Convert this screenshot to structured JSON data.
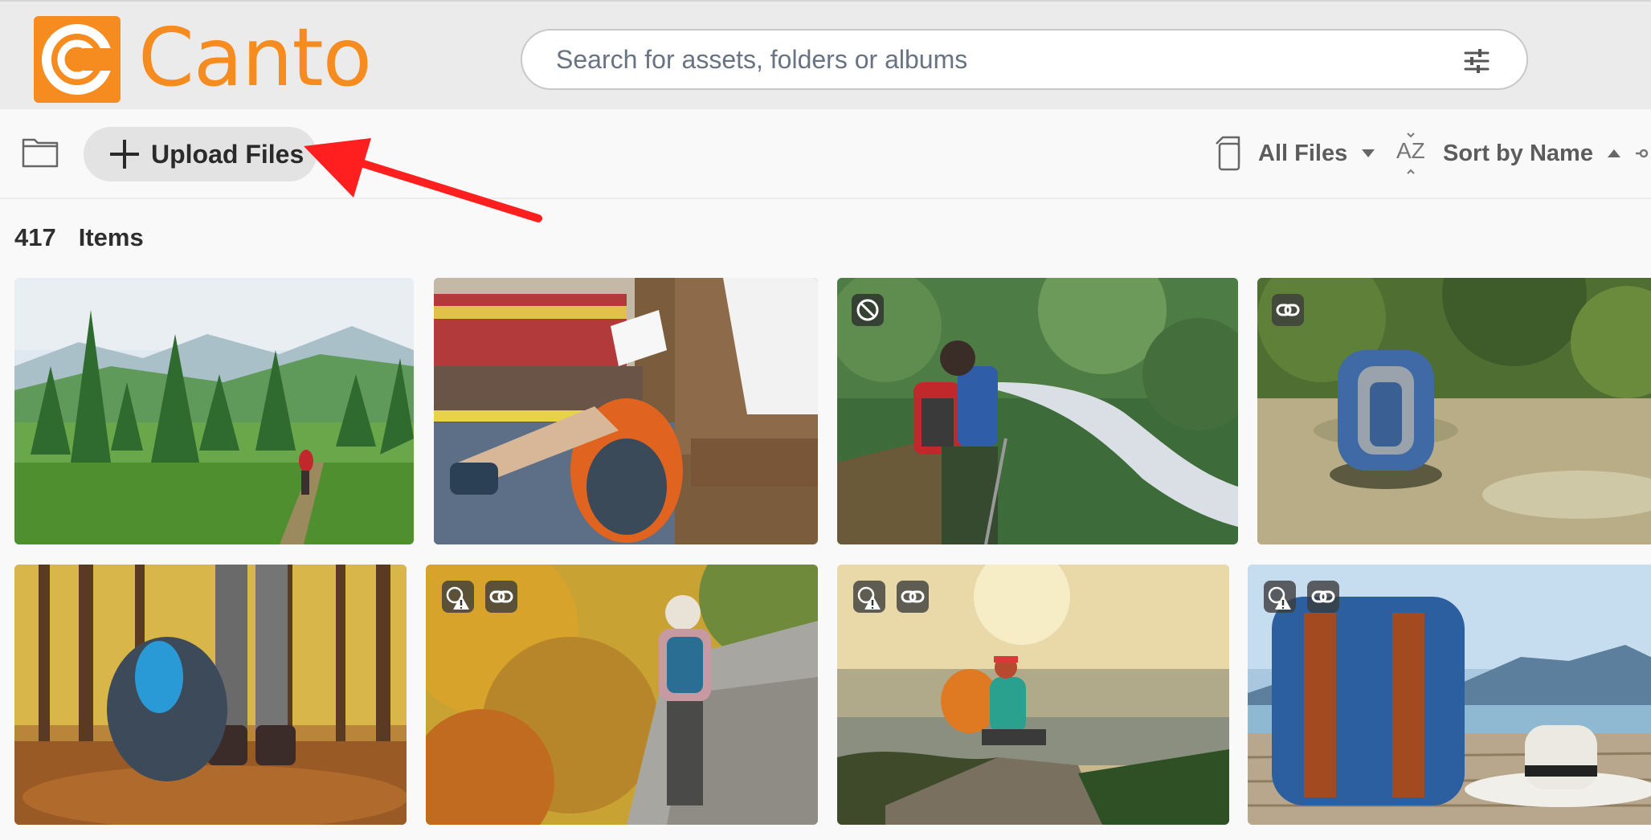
{
  "app": {
    "name": "Canto"
  },
  "brand": {
    "accent": "#f68b1f",
    "annotation": "#ff1f1f"
  },
  "search": {
    "placeholder": "Search for assets, folders or albums"
  },
  "toolbar": {
    "upload_label": "Upload Files",
    "files_filter_label": "All Files",
    "sort_label": "Sort by Name",
    "sort_icon_text": "AZ"
  },
  "summary": {
    "count": "417",
    "items_label": "Items"
  },
  "icons": {
    "logo": "canto-logo-icon",
    "filter": "filter-sliders-icon",
    "folder": "folder-icon",
    "upload": "plus-icon",
    "files": "copy-files-icon",
    "sort": "sort-az-icon",
    "restricted": "no-entry-icon",
    "warning": "expiry-warning-icon",
    "link": "link-icon"
  },
  "assets": [
    {
      "badges": []
    },
    {
      "badges": []
    },
    {
      "badges": [
        "restricted"
      ]
    },
    {
      "badges": [
        "link"
      ]
    },
    {
      "badges": []
    },
    {
      "badges": [
        "warning",
        "link"
      ]
    },
    {
      "badges": [
        "warning",
        "link"
      ]
    },
    {
      "badges": [
        "warning",
        "link"
      ]
    }
  ]
}
